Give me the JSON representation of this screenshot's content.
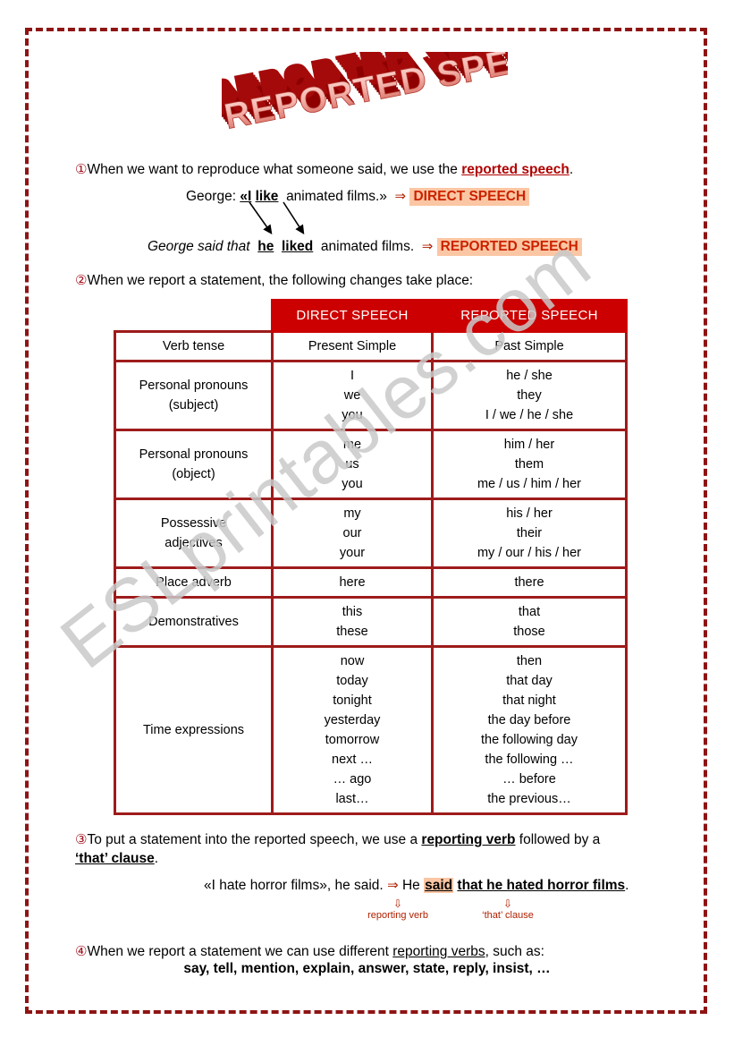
{
  "page": {
    "title_art": "REPORTED SPEECH",
    "watermark": "ESLprintables.com",
    "border_color": "#8E1414"
  },
  "colors": {
    "header_red": "#CC0000",
    "table_border_red": "#9E1B1B",
    "accent_red": "#B00000",
    "highlight_peach": "#FBC6A3",
    "tag_text_red": "#CC2200",
    "watermark_grey": "#C9C9C9"
  },
  "sections": {
    "one": {
      "marker": "①",
      "text_before": "When we want to reproduce what someone said, we use the ",
      "emphasis": "reported speech",
      "text_after": ".",
      "example_direct": {
        "speaker": "George:",
        "quote_open": "«I",
        "verb": "like",
        "rest": "animated films.»",
        "arrow": "⇒",
        "tag": "DIRECT SPEECH"
      },
      "example_reported": {
        "lead": "George said that",
        "pronoun": "he",
        "verb": "liked",
        "rest": "animated films.",
        "arrow": "⇒",
        "tag": "REPORTED SPEECH"
      }
    },
    "two": {
      "marker": "②",
      "text": "When we report a statement, the following changes take place:"
    },
    "three": {
      "marker": "③",
      "text_1": "To put a statement into the reported speech, we use a ",
      "emphasis_1": "reporting verb",
      "text_2": " followed by a ",
      "emphasis_2": "‘that’ clause",
      "text_3": ".",
      "example": {
        "direct": "«I hate horror films», he said.",
        "arrow": "⇒",
        "he": "He",
        "said": "said",
        "clause": "that he hated horror films",
        "period": "."
      },
      "notes": {
        "arrow_glyph": "⇩",
        "label_left": "reporting verb",
        "label_right": "‘that’ clause"
      }
    },
    "four": {
      "marker": "④",
      "text_before": "When we report a statement we can use different ",
      "emphasis": "reporting verbs",
      "text_after": ", such as:",
      "verbs": "say, tell, mention, explain, answer, state, reply, insist, …"
    }
  },
  "table": {
    "headers": [
      "",
      "DIRECT SPEECH",
      "REPORTED SPEECH"
    ],
    "rows": [
      {
        "label": "Verb tense",
        "direct": "Present Simple",
        "reported": "Past Simple"
      },
      {
        "label": "Personal pronouns\n(subject)",
        "direct": "I\nwe\nyou",
        "reported": "he / she\nthey\nI / we / he / she"
      },
      {
        "label": "Personal pronouns\n(object)",
        "direct": "me\nus\nyou",
        "reported": "him / her\nthem\nme / us / him / her"
      },
      {
        "label": "Possessive\nadjectives",
        "direct": "my\nour\nyour",
        "reported": "his / her\ntheir\nmy / our / his / her"
      },
      {
        "label": "Place adverb",
        "direct": "here",
        "reported": "there"
      },
      {
        "label": "Demonstratives",
        "direct": "this\nthese",
        "reported": "that\nthose"
      },
      {
        "label": "Time expressions",
        "direct": "now\ntoday\ntonight\nyesterday\ntomorrow\nnext …\n… ago\nlast…",
        "reported": "then\nthat day\nthat night\nthe day before\nthe following day\nthe following …\n… before\nthe previous…"
      }
    ]
  }
}
